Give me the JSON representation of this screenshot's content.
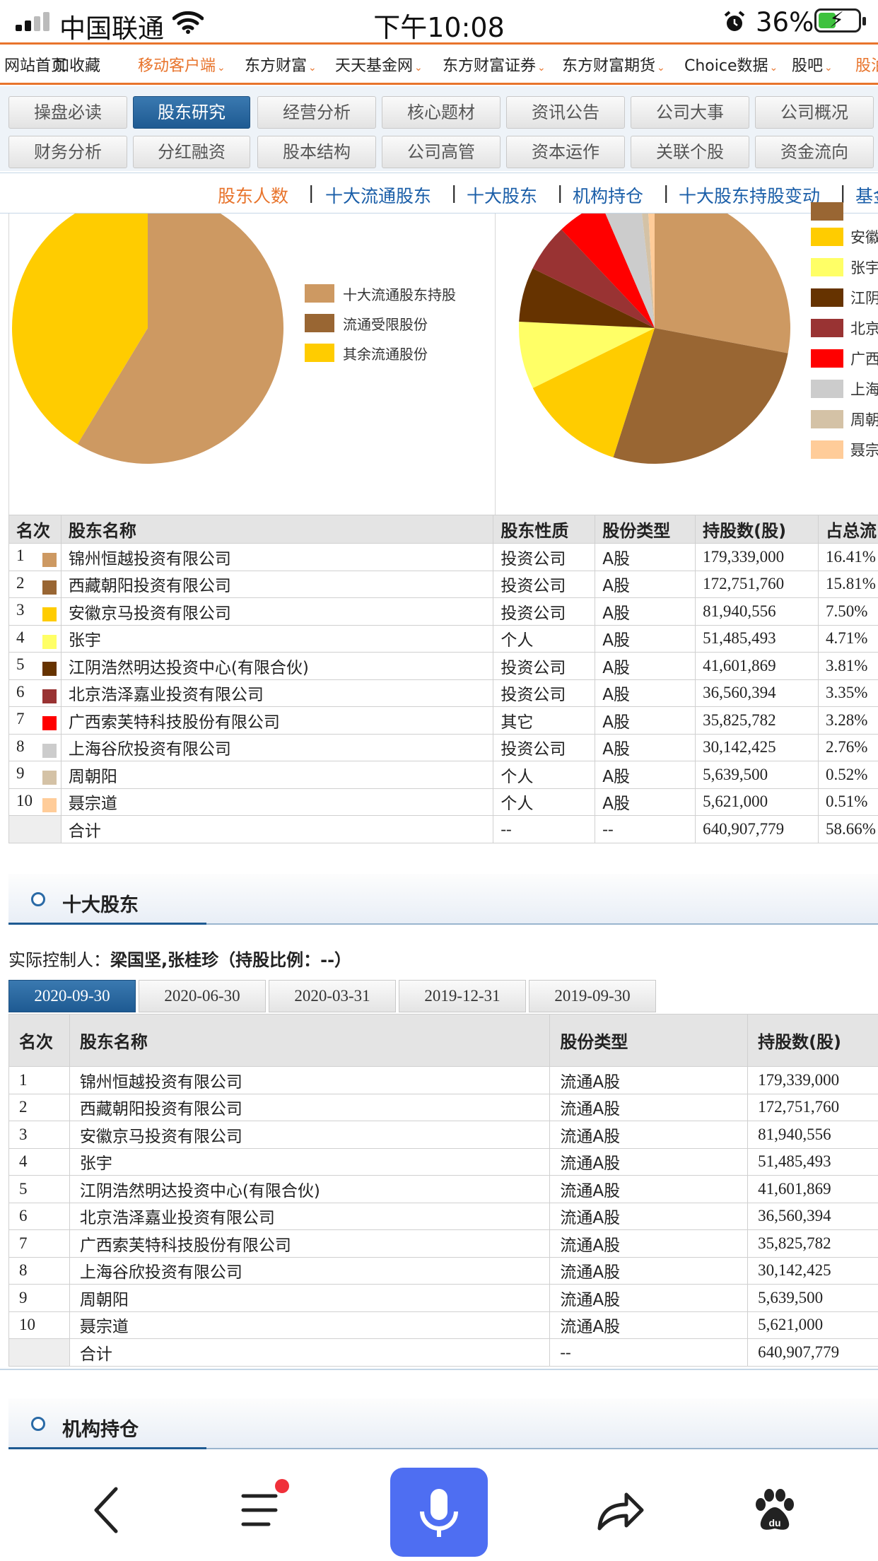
{
  "status": {
    "carrier": "中国联通",
    "time": "下午10:08",
    "battery": "36%"
  },
  "topnav": [
    {
      "label": "网站首页",
      "highlight": false,
      "arrow": false
    },
    {
      "label": "加收藏",
      "highlight": false,
      "arrow": false
    },
    {
      "label": "移动客户端",
      "highlight": true,
      "arrow": true
    },
    {
      "label": "东方财富",
      "highlight": false,
      "arrow": true
    },
    {
      "label": "天天基金网",
      "highlight": false,
      "arrow": true
    },
    {
      "label": "东方财富证券",
      "highlight": false,
      "arrow": true
    },
    {
      "label": "东方财富期货",
      "highlight": false,
      "arrow": true
    },
    {
      "label": "Choice数据",
      "highlight": false,
      "arrow": true
    },
    {
      "label": "股吧",
      "highlight": false,
      "arrow": true
    },
    {
      "label": "股油",
      "highlight": true,
      "arrow": false
    }
  ],
  "tabs": {
    "row1": [
      "操盘必读",
      "股东研究",
      "经营分析",
      "核心题材",
      "资讯公告",
      "公司大事",
      "公司概况"
    ],
    "row2": [
      "财务分析",
      "分红融资",
      "股本结构",
      "公司高管",
      "资本运作",
      "关联个股",
      "资金流向"
    ],
    "active": "股东研究"
  },
  "subtabs": [
    "股东人数",
    "十大流通股东",
    "十大股东",
    "机构持仓",
    "十大股东持股变动",
    "基金"
  ],
  "colors": {
    "c1": "#cd9962",
    "c2": "#996633",
    "c3": "#ffcc00",
    "c4": "#ffff66",
    "c5": "#663300",
    "c6": "#993333",
    "c7": "#ff0000",
    "c8": "#cccccc",
    "c9": "#d4c2a6",
    "c10": "#ffcc99",
    "accent": "#e8742c",
    "tabBlue": "#1e5a92"
  },
  "pie1": {
    "legend": [
      "十大流通股东持股",
      "流通受限股份",
      "其余流通股份"
    ],
    "values": [
      58.66,
      0,
      41.34
    ]
  },
  "pie2": {
    "legend_visible": [
      "安徽",
      "张宇",
      "江阴",
      "北京",
      "广西",
      "上海",
      "周朝",
      "聂宗"
    ]
  },
  "table1": {
    "headers": [
      "名次",
      "股东名称",
      "股东性质",
      "股份类型",
      "持股数(股)",
      "占总流"
    ],
    "rows": [
      {
        "rank": "1",
        "name": "锦州恒越投资有限公司",
        "nature": "投资公司",
        "type": "A股",
        "shares": "179,339,000",
        "pct": "16.41%"
      },
      {
        "rank": "2",
        "name": "西藏朝阳投资有限公司",
        "nature": "投资公司",
        "type": "A股",
        "shares": "172,751,760",
        "pct": "15.81%"
      },
      {
        "rank": "3",
        "name": "安徽京马投资有限公司",
        "nature": "投资公司",
        "type": "A股",
        "shares": "81,940,556",
        "pct": "7.50%"
      },
      {
        "rank": "4",
        "name": "张宇",
        "nature": "个人",
        "type": "A股",
        "shares": "51,485,493",
        "pct": "4.71%"
      },
      {
        "rank": "5",
        "name": "江阴浩然明达投资中心(有限合伙)",
        "nature": "投资公司",
        "type": "A股",
        "shares": "41,601,869",
        "pct": "3.81%"
      },
      {
        "rank": "6",
        "name": "北京浩泽嘉业投资有限公司",
        "nature": "投资公司",
        "type": "A股",
        "shares": "36,560,394",
        "pct": "3.35%"
      },
      {
        "rank": "7",
        "name": "广西索芙特科技股份有限公司",
        "nature": "其它",
        "type": "A股",
        "shares": "35,825,782",
        "pct": "3.28%"
      },
      {
        "rank": "8",
        "name": "上海谷欣投资有限公司",
        "nature": "投资公司",
        "type": "A股",
        "shares": "30,142,425",
        "pct": "2.76%"
      },
      {
        "rank": "9",
        "name": "周朝阳",
        "nature": "个人",
        "type": "A股",
        "shares": "5,639,500",
        "pct": "0.52%"
      },
      {
        "rank": "10",
        "name": "聂宗道",
        "nature": "个人",
        "type": "A股",
        "shares": "5,621,000",
        "pct": "0.51%"
      }
    ],
    "total": {
      "label": "合计",
      "nature": "--",
      "type": "--",
      "shares": "640,907,779",
      "pct": "58.66%"
    }
  },
  "section1": {
    "title": "十大股东"
  },
  "controller": {
    "label": "实际控制人：",
    "value": "梁国坚,张桂珍",
    "ratio": "（持股比例：--）"
  },
  "dates": [
    "2020-09-30",
    "2020-06-30",
    "2020-03-31",
    "2019-12-31",
    "2019-09-30"
  ],
  "table2": {
    "headers": [
      "名次",
      "股东名称",
      "股份类型",
      "持股数(股)"
    ],
    "rows": [
      {
        "rank": "1",
        "name": "锦州恒越投资有限公司",
        "type": "流通A股",
        "shares": "179,339,000"
      },
      {
        "rank": "2",
        "name": "西藏朝阳投资有限公司",
        "type": "流通A股",
        "shares": "172,751,760"
      },
      {
        "rank": "3",
        "name": "安徽京马投资有限公司",
        "type": "流通A股",
        "shares": "81,940,556"
      },
      {
        "rank": "4",
        "name": "张宇",
        "type": "流通A股",
        "shares": "51,485,493"
      },
      {
        "rank": "5",
        "name": "江阴浩然明达投资中心(有限合伙)",
        "type": "流通A股",
        "shares": "41,601,869"
      },
      {
        "rank": "6",
        "name": "北京浩泽嘉业投资有限公司",
        "type": "流通A股",
        "shares": "36,560,394"
      },
      {
        "rank": "7",
        "name": "广西索芙特科技股份有限公司",
        "type": "流通A股",
        "shares": "35,825,782"
      },
      {
        "rank": "8",
        "name": "上海谷欣投资有限公司",
        "type": "流通A股",
        "shares": "30,142,425"
      },
      {
        "rank": "9",
        "name": "周朝阳",
        "type": "流通A股",
        "shares": "5,639,500"
      },
      {
        "rank": "10",
        "name": "聂宗道",
        "type": "流通A股",
        "shares": "5,621,000"
      }
    ],
    "total": {
      "label": "合计",
      "type": "--",
      "shares": "640,907,779"
    }
  },
  "section2": {
    "title": "机构持仓"
  },
  "bottombar": {
    "icons": [
      "back-icon",
      "menu-icon",
      "microphone-icon",
      "share-icon",
      "baidu-paw-icon"
    ]
  }
}
